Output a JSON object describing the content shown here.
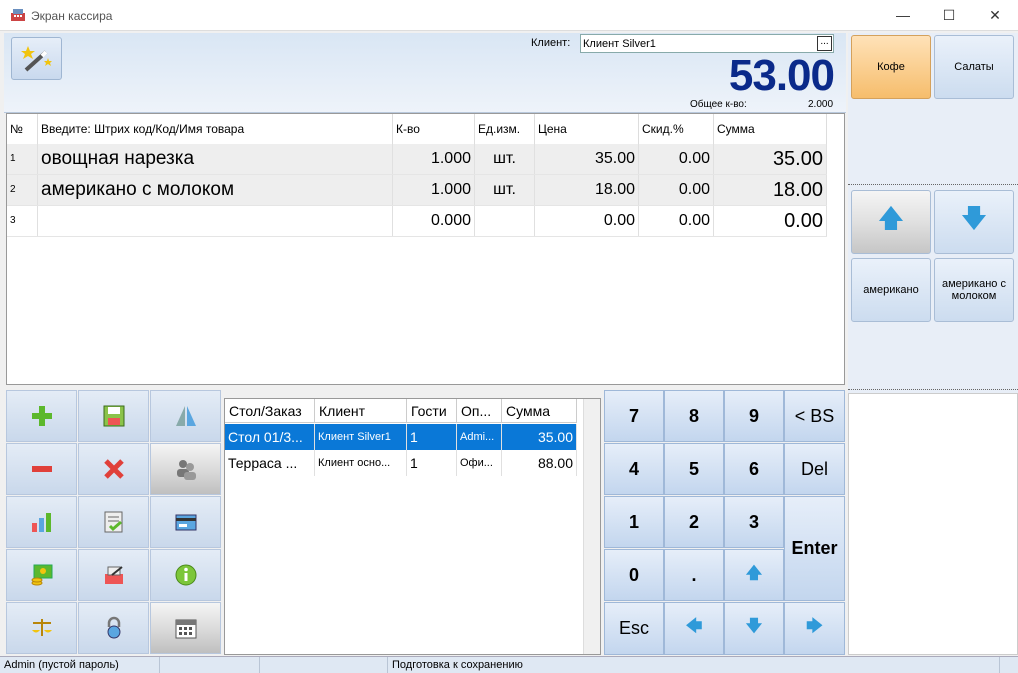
{
  "window": {
    "title": "Экран кассира",
    "minimize": "—",
    "maximize": "☐",
    "close": "✕"
  },
  "header": {
    "client_label": "Клиент:",
    "client_value": "Клиент Silver1",
    "client_browse": "...",
    "total": "53.00",
    "qty_label": "Общее к-во:",
    "qty_value": "2.000"
  },
  "grid": {
    "columns": [
      "№",
      "Введите: Штрих код/Код/Имя товара",
      "К-во",
      "Ед.изм.",
      "Цена",
      "Скид.%",
      "Сумма"
    ],
    "rows": [
      {
        "n": "1",
        "name": "овощная нарезка",
        "qty": "1.000",
        "unit": "шт.",
        "price": "35.00",
        "disc": "0.00",
        "sum": "35.00"
      },
      {
        "n": "2",
        "name": "американо с молоком",
        "qty": "1.000",
        "unit": "шт.",
        "price": "18.00",
        "disc": "0.00",
        "sum": "18.00"
      },
      {
        "n": "3",
        "name": "",
        "qty": "0.000",
        "unit": "",
        "price": "0.00",
        "disc": "0.00",
        "sum": "0.00"
      }
    ]
  },
  "categories": [
    "Кофе",
    "Салаты"
  ],
  "products": [
    "американо",
    "американо с молоком"
  ],
  "orders": {
    "columns": [
      "Стол/Заказ",
      "Клиент",
      "Гости",
      "Оп...",
      "Сумма"
    ],
    "rows": [
      {
        "order": "Стол 01/3...",
        "client": "Клиент Silver1",
        "guests": "1",
        "op": "Admi...",
        "sum": "35.00"
      },
      {
        "order": "Терраса ...",
        "client": "Клиент осно...",
        "guests": "1",
        "op": "Офи...",
        "sum": "88.00"
      }
    ]
  },
  "numpad": {
    "k7": "7",
    "k8": "8",
    "k9": "9",
    "bs": "< BS",
    "k4": "4",
    "k5": "5",
    "k6": "6",
    "del": "Del",
    "k1": "1",
    "k2": "2",
    "k3": "3",
    "enter": "Enter",
    "k0": "0",
    "dot": ".",
    "esc": "Esc"
  },
  "status": {
    "user": "Admin (пустой пароль)",
    "message": "Подготовка к сохранению"
  },
  "colors": {
    "accent": "#0b2a8a",
    "selection": "#0a78d7",
    "category_active": "#f6bd6c",
    "arrow": "#2f9ad9"
  }
}
